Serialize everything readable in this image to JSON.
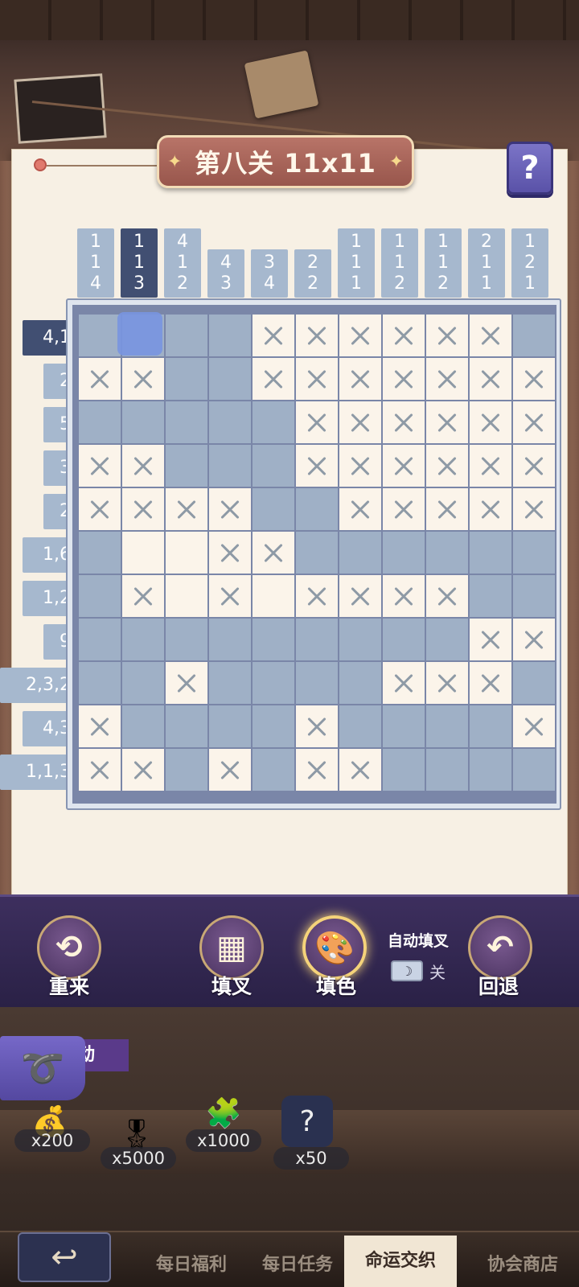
{
  "header": {
    "title": "第八关 11x11",
    "help_label": "?"
  },
  "puzzle": {
    "size": 11,
    "active_column": 1,
    "active_row": 0,
    "column_clues": [
      [
        "1",
        "1",
        "4"
      ],
      [
        "1",
        "1",
        "3"
      ],
      [
        "4",
        "1",
        "2"
      ],
      [
        "4",
        "3"
      ],
      [
        "3",
        "4"
      ],
      [
        "2",
        "2"
      ],
      [
        "1",
        "1",
        "1"
      ],
      [
        "1",
        "1",
        "2"
      ],
      [
        "1",
        "1",
        "2"
      ],
      [
        "2",
        "1",
        "1"
      ],
      [
        "1",
        "2",
        "1"
      ]
    ],
    "row_clues": [
      "4,1",
      "2",
      "5",
      "3",
      "2",
      "1,6",
      "1,2",
      "9",
      "2,3,2",
      "4,3",
      "1,1,3"
    ],
    "grid": [
      "ffffxxxxxxf",
      "xxffxxxxxxx",
      "fffffxxxxxx",
      "xxfffxxxxxx",
      "xxxxffxxxxx",
      "feexxffffff",
      "fxexexxxxff",
      "fffffffffxx",
      "ffxffffxxxff",
      "xffffxffffxx",
      "xxfxfxxffffx"
    ]
  },
  "tools": {
    "restart": {
      "label": "重来",
      "icon": "restart-icon"
    },
    "cross": {
      "label": "填叉",
      "icon": "cross-grid-icon"
    },
    "fill": {
      "label": "填色",
      "icon": "palette-icon"
    },
    "undo": {
      "label": "回退",
      "icon": "undo-icon"
    },
    "auto_cross": {
      "label": "自动填叉",
      "state": "关",
      "toggle_icon": "moon-icon"
    }
  },
  "event": {
    "tab_label": "动"
  },
  "rewards": [
    {
      "icon": "coin-bag-icon",
      "count": "x200",
      "color": "#c88a3a"
    },
    {
      "icon": "badge-icon",
      "count": "x5000",
      "color": "#b8875a"
    },
    {
      "icon": "puzzle-piece-icon",
      "count": "x1000",
      "color": "#7a3aa8"
    },
    {
      "icon": "mystery-card-icon",
      "count": "x50",
      "color": "#2a3150"
    }
  ],
  "nav": {
    "back_icon": "back-arrow-icon",
    "tabs": [
      {
        "label": "每日福利",
        "active": false
      },
      {
        "label": "每日任务",
        "active": false
      },
      {
        "label": "命运交织",
        "active": true
      },
      {
        "label": "协会商店",
        "active": false
      }
    ]
  }
}
